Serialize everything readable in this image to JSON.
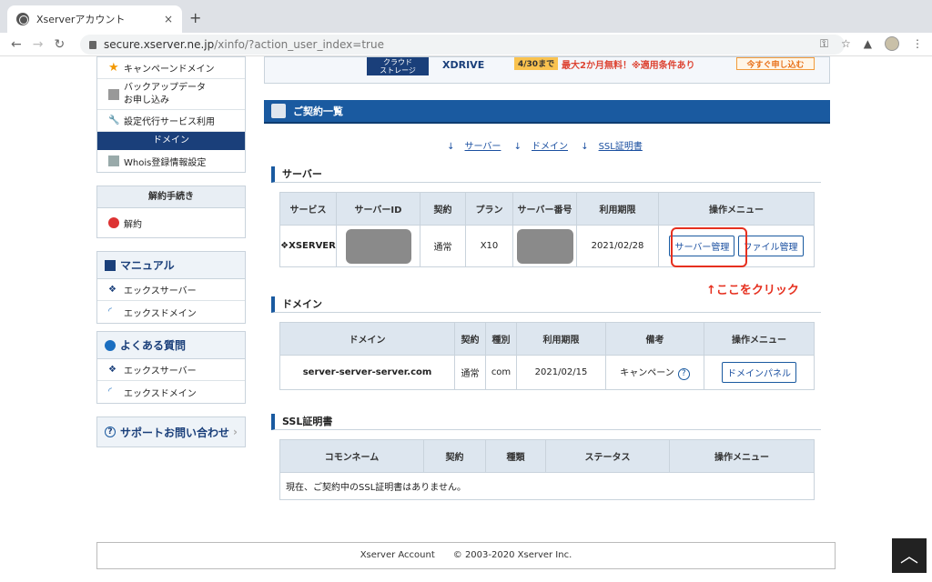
{
  "browser": {
    "tab_title": "Xserverアカウント",
    "tab_close": "×",
    "new_tab": "+",
    "url_host": "secure.xserver.ne.jp",
    "url_path": "/xinfo/?action_user_index=true"
  },
  "sidebar": {
    "top_items": [
      "キャンペーンドメイン",
      "バックアップデータ\nお申し込み",
      "設定代行サービス利用"
    ],
    "domain_header": "ドメイン",
    "whois": "Whois登録情報設定",
    "cancel_header": "解約手続き",
    "cancel_item": "解約",
    "manual_header": "マニュアル",
    "manual_items": [
      "エックスサーバー",
      "エックスドメイン"
    ],
    "faq_header": "よくある質問",
    "faq_items": [
      "エックスサーバー",
      "エックスドメイン"
    ],
    "support": "サポートお問い合わせ"
  },
  "banner": {
    "label": "クラウド\nストレージ",
    "product": "XDRIVE",
    "date": "4/30まで",
    "promo": "最大2か月無料！※適用条件あり",
    "cta": "今すぐ申し込む"
  },
  "contracts": {
    "title": "ご契約一覧",
    "anchors": [
      "サーバー",
      "ドメイン",
      "SSL証明書"
    ],
    "server": {
      "heading": "サーバー",
      "columns": [
        "サービス",
        "サーバーID",
        "契約",
        "プラン",
        "サーバー番号",
        "利用期限",
        "操作メニュー"
      ],
      "row": {
        "service": "XSERVER",
        "contract": "通常",
        "plan": "X10",
        "expiry": "2021/02/28",
        "btn_manage": "サーバー管理",
        "btn_files": "ファイル管理"
      }
    },
    "note": "↑ここをクリック",
    "domain": {
      "heading": "ドメイン",
      "columns": [
        "ドメイン",
        "契約",
        "種別",
        "利用期限",
        "備考",
        "操作メニュー"
      ],
      "row": {
        "domain": "server-server-server.com",
        "contract": "通常",
        "type": "com",
        "expiry": "2021/02/15",
        "remark": "キャンペーン",
        "btn": "ドメインパネル"
      }
    },
    "ssl": {
      "heading": "SSL証明書",
      "columns": [
        "コモンネーム",
        "契約",
        "種類",
        "ステータス",
        "操作メニュー"
      ],
      "empty": "現在、ご契約中のSSL証明書はありません。"
    }
  },
  "footer": "Xserver Account　　© 2003-2020 Xserver Inc.",
  "colors": {
    "accent": "#1a5aa0",
    "highlight": "#e6301f"
  }
}
